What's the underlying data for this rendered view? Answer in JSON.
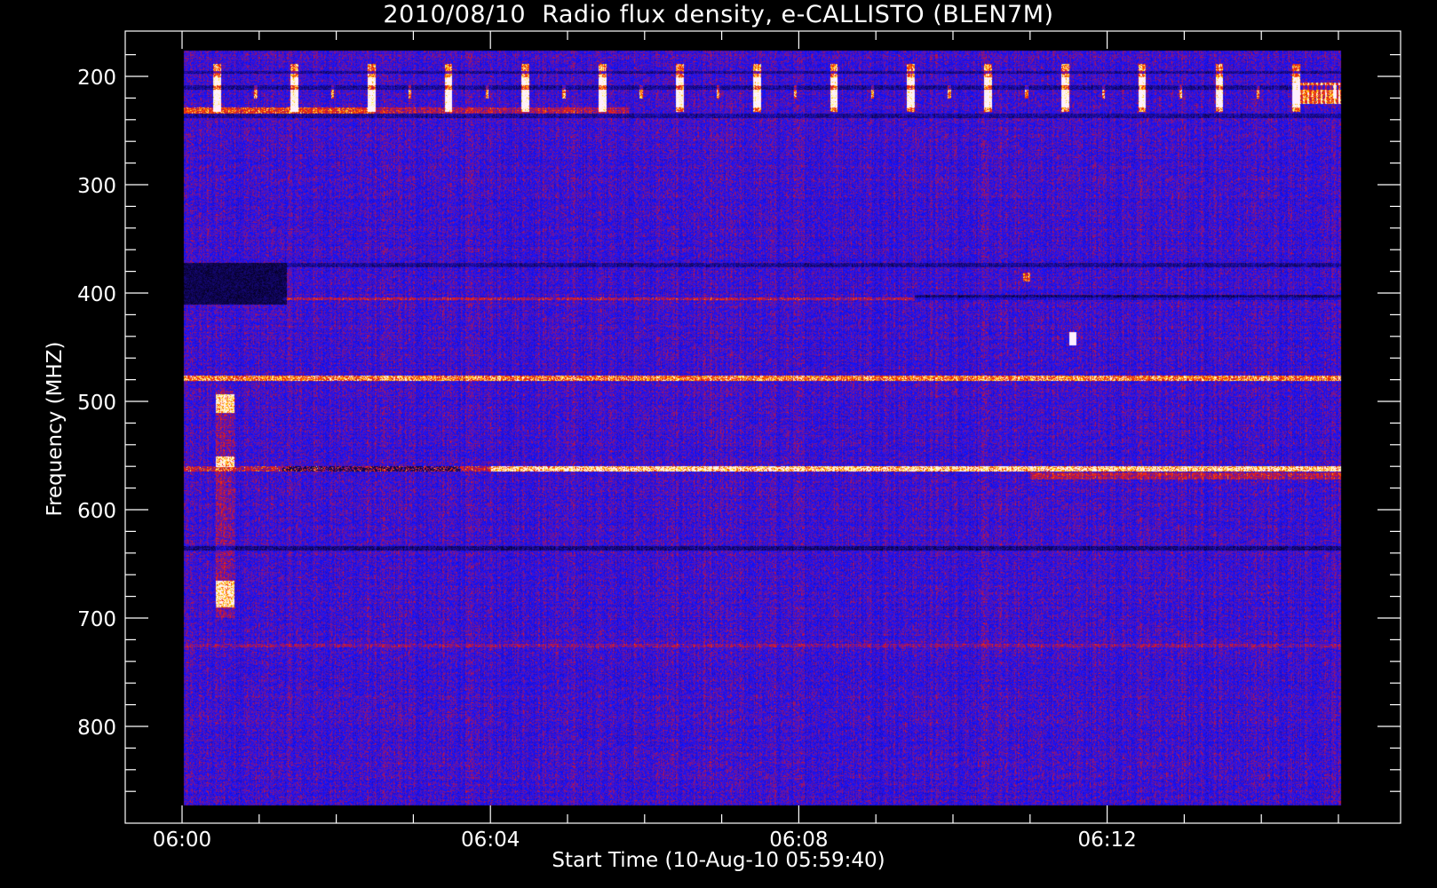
{
  "chart_data": {
    "type": "heatmap",
    "title": "2010/08/10  Radio flux density, e-CALLISTO (BLEN7M)",
    "xlabel": "Start Time (10-Aug-10 05:59:40)",
    "ylabel": "Frequency (MHZ)",
    "x_ticks": [
      "06:00",
      "06:04",
      "06:08",
      "06:12"
    ],
    "y_ticks": [
      200,
      300,
      400,
      500,
      600,
      700,
      800
    ],
    "x_range_minutes": [
      0,
      15
    ],
    "y_range_mhz": [
      178,
      870
    ],
    "colormap": "blue-red-yellow-white",
    "features": [
      {
        "name": "periodic bursts",
        "freq_mhz": [
          190,
          230
        ],
        "period_minutes": 1.0
      },
      {
        "name": "continuous emission line",
        "freq_mhz": 231
      },
      {
        "name": "dark band",
        "freq_mhz": [
          372,
          410
        ],
        "minutes": [
          0,
          1.35
        ]
      },
      {
        "name": "bright line",
        "freq_mhz": 478
      },
      {
        "name": "strong line",
        "freq_mhz": 562
      },
      {
        "name": "dark line",
        "freq_mhz": 635
      },
      {
        "name": "burst",
        "minutes": 0.55,
        "freq_mhz": [
          490,
          700
        ]
      },
      {
        "name": "spot",
        "minutes": 11.55,
        "freq_mhz": 442
      }
    ]
  },
  "colors": {
    "background": "#000000",
    "foreground": "#ffffff",
    "base": "#2a14ee"
  }
}
